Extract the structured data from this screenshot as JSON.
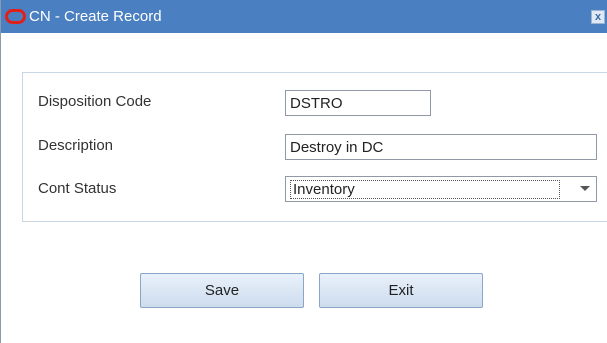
{
  "window": {
    "title": "CN - Create Record",
    "close_glyph": "x",
    "logo_icon": "oracle-logo-icon",
    "close_icon": "close-icon"
  },
  "form": {
    "disposition_code": {
      "label": "Disposition Code",
      "value": "DSTRO"
    },
    "description": {
      "label": "Description",
      "value": "Destroy in DC"
    },
    "cont_status": {
      "label": "Cont Status",
      "value": "Inventory"
    }
  },
  "buttons": {
    "save_label": "Save",
    "exit_label": "Exit"
  },
  "colors": {
    "titlebar": "#4a7fc1",
    "logo": "#e0201b",
    "button_top": "#e9f1fa",
    "button_bottom": "#cddcee"
  }
}
